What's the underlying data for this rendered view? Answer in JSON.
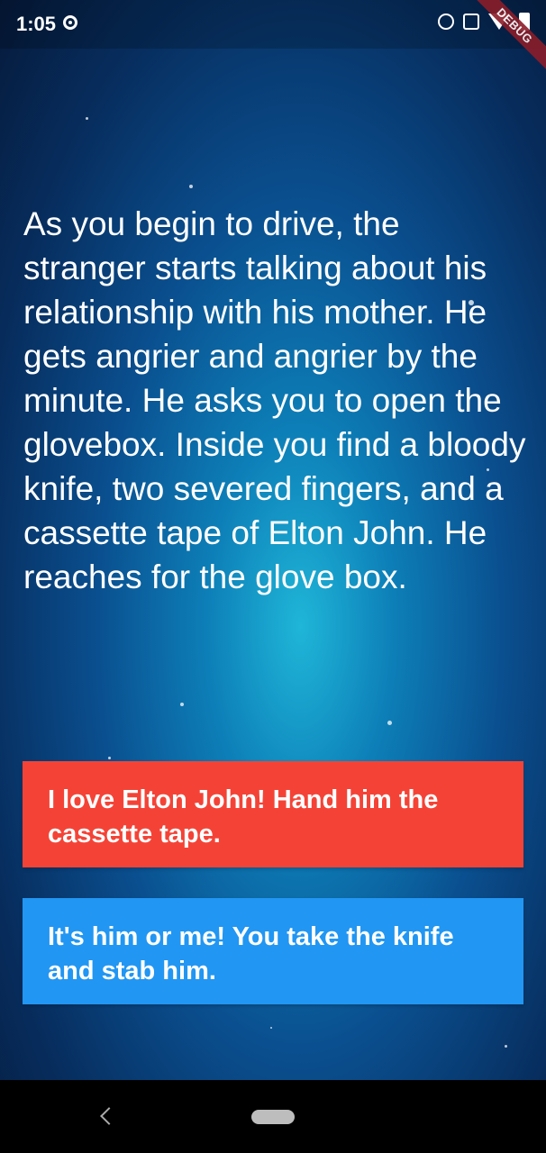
{
  "status_bar": {
    "time": "1:05",
    "icons": [
      "sync-icon",
      "alarm-icon",
      "vibrate-icon",
      "wifi-icon",
      "battery-icon"
    ]
  },
  "debug_banner": {
    "label": "DEBUG"
  },
  "story": {
    "text": "As you begin to drive, the stranger starts talking about his relationship with his mother. He gets angrier and angrier by the minute. He asks you to open the glovebox. Inside you find a bloody knife, two severed fingers, and a cassette tape of Elton John. He reaches for the glove box."
  },
  "choices": {
    "choice1": "I love Elton John! Hand him the cassette tape.",
    "choice2": "It's him or me! You take the knife and stab him."
  },
  "colors": {
    "choice1_bg": "#f44336",
    "choice2_bg": "#2196f3"
  }
}
